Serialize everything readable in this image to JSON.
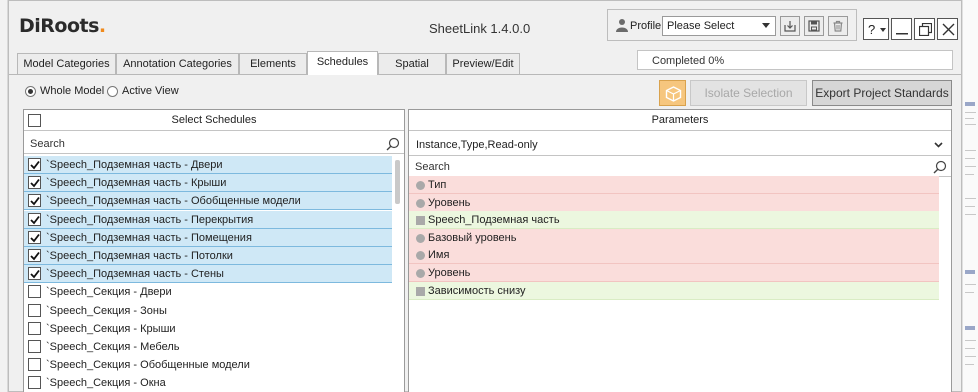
{
  "app": {
    "logo_main": "DiRoots",
    "logo_dot": ".",
    "title": "SheetLink 1.4.0.0"
  },
  "profile": {
    "label": "Profile",
    "selected": "Please Select"
  },
  "window_controls": {
    "help": "?"
  },
  "progress": {
    "text": "Completed  0%",
    "value_percent": 0
  },
  "tabs": [
    {
      "label": "Model Categories",
      "active": false
    },
    {
      "label": "Annotation Categories",
      "active": false
    },
    {
      "label": "Elements",
      "active": false
    },
    {
      "label": "Schedules",
      "active": true
    },
    {
      "label": "Spatial",
      "active": false
    },
    {
      "label": "Preview/Edit",
      "active": false
    }
  ],
  "scope": {
    "whole_model": "Whole Model",
    "active_view": "Active View",
    "selected": "whole_model"
  },
  "actions": {
    "isolate": "Isolate Selection",
    "export": "Export Project Standards"
  },
  "schedules": {
    "header": "Select Schedules",
    "search_placeholder": "Search",
    "items": [
      {
        "label": "`Speech_Подземная часть - Двери",
        "checked": true
      },
      {
        "label": "`Speech_Подземная часть - Крыши",
        "checked": true
      },
      {
        "label": "`Speech_Подземная часть - Обобщенные модели",
        "checked": true
      },
      {
        "label": "`Speech_Подземная часть - Перекрытия",
        "checked": true
      },
      {
        "label": "`Speech_Подземная часть - Помещения",
        "checked": true
      },
      {
        "label": "`Speech_Подземная часть - Потолки",
        "checked": true
      },
      {
        "label": "`Speech_Подземная часть - Стены",
        "checked": true
      },
      {
        "label": "`Speech_Секция - Двери",
        "checked": false
      },
      {
        "label": "`Speech_Секция - Зоны",
        "checked": false
      },
      {
        "label": "`Speech_Секция - Крыши",
        "checked": false
      },
      {
        "label": "`Speech_Секция - Мебель",
        "checked": false
      },
      {
        "label": "`Speech_Секция - Обобщенные модели",
        "checked": false
      },
      {
        "label": "`Speech_Секция - Окна",
        "checked": false
      }
    ]
  },
  "parameters": {
    "header": "Parameters",
    "filter": "Instance,Type,Read-only",
    "search_placeholder": "Search",
    "items": [
      {
        "label": "Тип",
        "kind": "read-only",
        "icon": "circle"
      },
      {
        "label": "Уровень",
        "kind": "read-only",
        "icon": "circle"
      },
      {
        "label": "Speech_Подземная часть",
        "kind": "instance",
        "icon": "square"
      },
      {
        "label": "Базовый уровень",
        "kind": "read-only",
        "icon": "circle"
      },
      {
        "label": "Имя",
        "kind": "read-only",
        "icon": "circle"
      },
      {
        "label": "Уровень",
        "kind": "read-only",
        "icon": "circle"
      },
      {
        "label": "Зависимость снизу",
        "kind": "instance",
        "icon": "square"
      }
    ]
  },
  "colors": {
    "accent": "#f08a1c",
    "selected_row": "#cfe8f6",
    "read_only_row": "#fadddb",
    "instance_row": "#ecf7df",
    "progress": "#6ac259"
  }
}
